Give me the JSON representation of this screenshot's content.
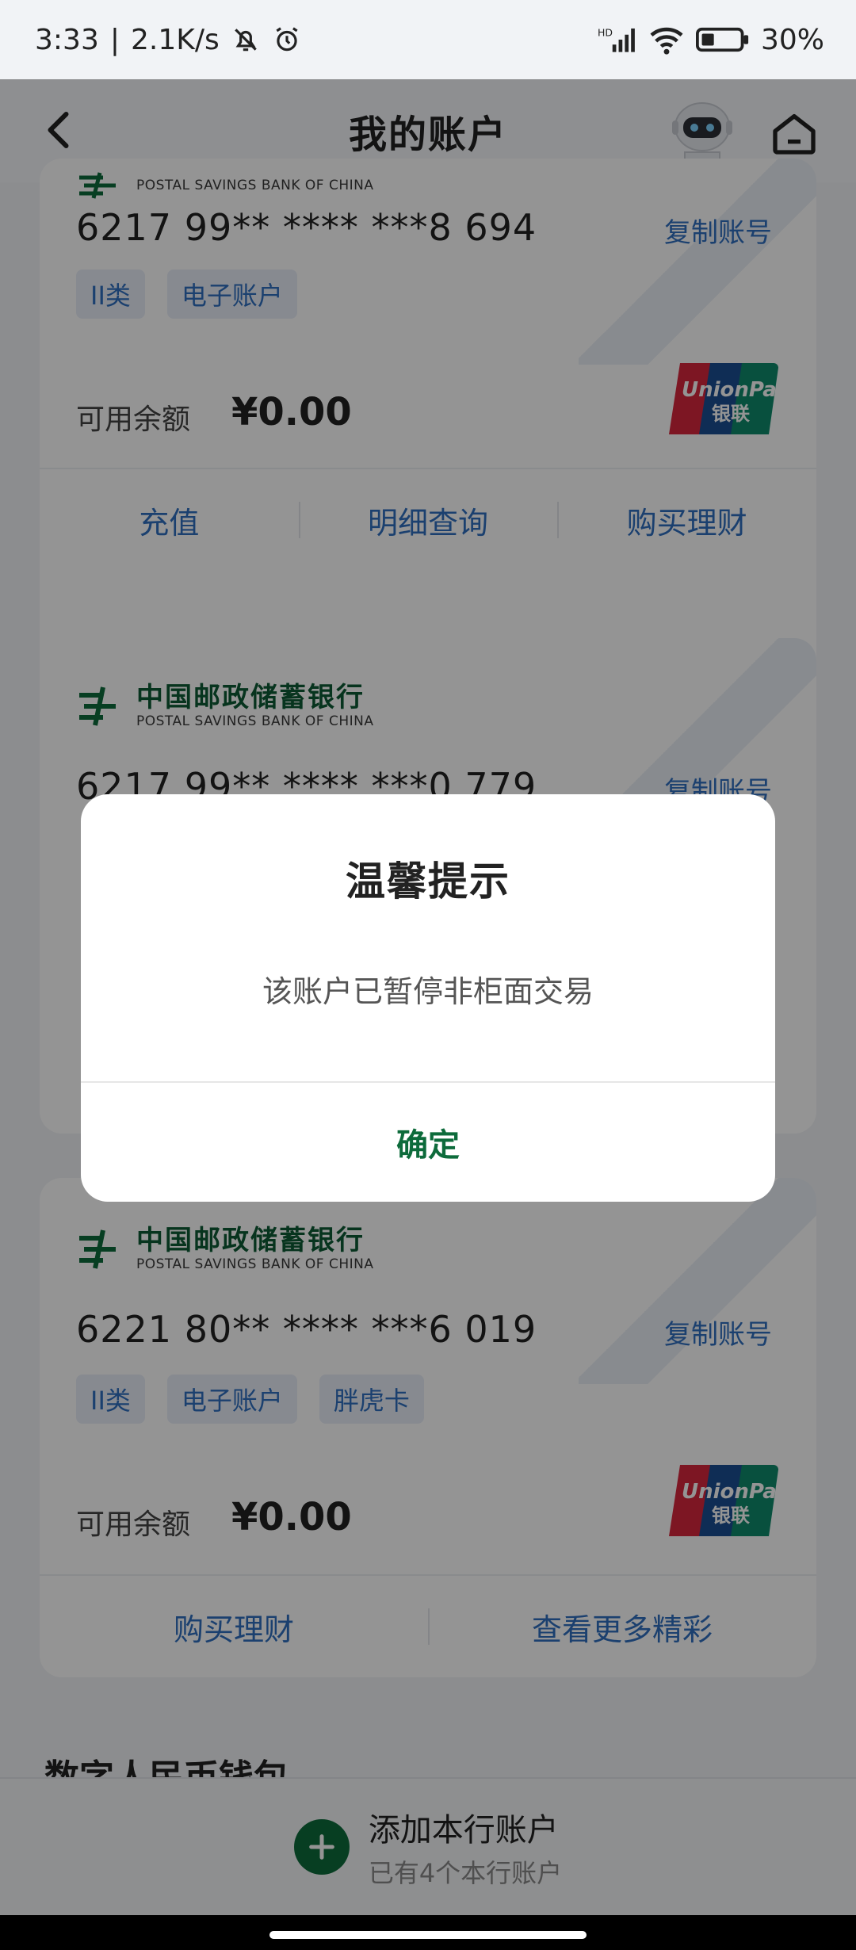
{
  "status_bar": {
    "time": "3:33",
    "network_speed": "2.1K/s",
    "battery": "30%",
    "icons": [
      "bell-off-icon",
      "alarm-icon",
      "hd-signal-icon",
      "wifi-icon",
      "battery-icon"
    ]
  },
  "header": {
    "title": "我的账户",
    "icons": [
      "back-arrow-icon",
      "robot-assistant-icon",
      "home-icon"
    ],
    "accent_color": "#f0b323"
  },
  "bank": {
    "name_cn": "中国邮政储蓄银行",
    "name_en": "POSTAL SAVINGS BANK OF CHINA",
    "brand_color": "#0d6b3b"
  },
  "cards": [
    {
      "number": "6217 99** **** ***8 694",
      "copy_label": "复制账号",
      "tags": [
        "II类",
        "电子账户"
      ],
      "balance_label": "可用余额",
      "balance": "¥0.00",
      "actions": [
        "充值",
        "明细查询",
        "购买理财"
      ]
    },
    {
      "number": "6217 99** **** ***0 779",
      "copy_label": "复制账号"
    },
    {
      "number": "6221 80** **** ***6 019",
      "copy_label": "复制账号",
      "tags": [
        "II类",
        "电子账户",
        "胖虎卡"
      ],
      "balance_label": "可用余额",
      "balance": "¥0.00",
      "actions": [
        "购买理财",
        "查看更多精彩"
      ]
    }
  ],
  "unionpay": {
    "line1": "UnionPay",
    "line2": "银联"
  },
  "section_title": "数字人民币钱包",
  "bottom_bar": {
    "add_label": "添加本行账户",
    "add_sub": "已有4个本行账户"
  },
  "dialog": {
    "title": "温馨提示",
    "message": "该账户已暂停非柜面交易",
    "confirm": "确定"
  },
  "link_color": "#2f6fc0"
}
